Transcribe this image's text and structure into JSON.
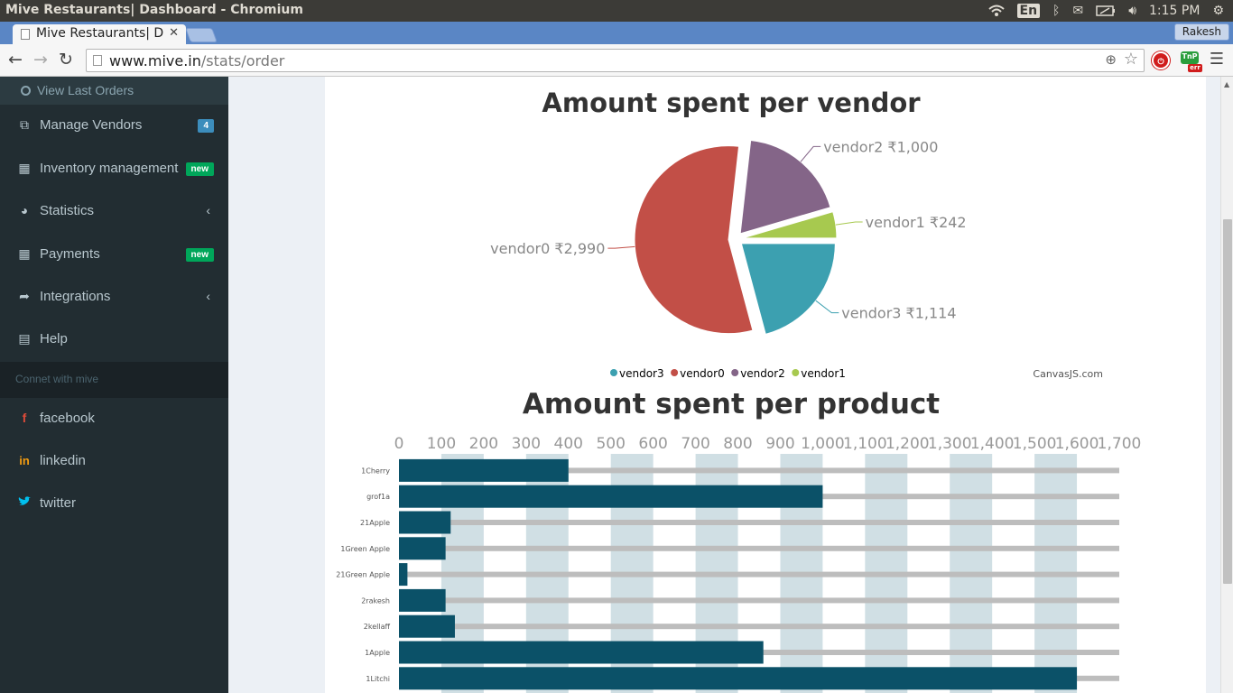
{
  "os": {
    "window_title": "Mive Restaurants| Dashboard - Chromium",
    "lang": "En",
    "clock": "1:15 PM"
  },
  "browser": {
    "tab_title": "Mive Restaurants| D",
    "profile": "Rakesh",
    "url_host": "www.mive.in",
    "url_path": "/stats/order",
    "ext_label": "TnP",
    "ext_badge": "err"
  },
  "sidebar": {
    "sub_item": "View Last Orders",
    "items": [
      {
        "label": "Manage Vendors",
        "icon": "copy-icon",
        "badge": "4"
      },
      {
        "label": "Inventory management",
        "icon": "grid-icon",
        "badge": "new"
      },
      {
        "label": "Statistics",
        "icon": "pie-icon",
        "chevron": "‹"
      },
      {
        "label": "Payments",
        "icon": "grid-icon",
        "badge": "new"
      },
      {
        "label": "Integrations",
        "icon": "share-icon",
        "chevron": "‹"
      },
      {
        "label": "Help",
        "icon": "book-icon"
      }
    ],
    "section_header": "Connet with mive",
    "social": [
      {
        "label": "facebook",
        "icon_glyph": "f",
        "color": "#dd4b39"
      },
      {
        "label": "linkedin",
        "icon_glyph": "in",
        "color": "#f39c12"
      },
      {
        "label": "twitter",
        "icon_glyph": "🐦",
        "color": "#00c0ef"
      }
    ]
  },
  "chart_data": [
    {
      "type": "pie",
      "title": "Amount spent per vendor",
      "slices": [
        {
          "name": "vendor3",
          "value": 1114,
          "label": "vendor3 ₹1,114",
          "color": "#3ca0b0"
        },
        {
          "name": "vendor0",
          "value": 2990,
          "label": "vendor0 ₹2,990",
          "color": "#c24f47"
        },
        {
          "name": "vendor2",
          "value": 1000,
          "label": "vendor2 ₹1,000",
          "color": "#846588"
        },
        {
          "name": "vendor1",
          "value": 242,
          "label": "vendor1 ₹242",
          "color": "#a7c94f"
        }
      ],
      "legend": [
        "vendor3",
        "vendor0",
        "vendor2",
        "vendor1"
      ],
      "legend_placement": "bottom",
      "credit": "CanvasJS.com"
    },
    {
      "type": "bar",
      "orientation": "horizontal",
      "title": "Amount spent per product",
      "categories": [
        "1Cherry",
        "grof1a",
        "21Apple",
        "1Green Apple",
        "21Green Apple",
        "2rakesh",
        "2kellaff",
        "1Apple",
        "1Litchi"
      ],
      "values": [
        400,
        1000,
        122,
        110,
        20,
        110,
        132,
        860,
        1600
      ],
      "ticks": [
        "0",
        "100",
        "200",
        "300",
        "400",
        "500",
        "600",
        "700",
        "800",
        "900",
        "1,000",
        "1,100",
        "1,200",
        "1,300",
        "1,400",
        "1,500",
        "1,600",
        "1,700"
      ],
      "xlim": [
        0,
        1700
      ],
      "axis_position": "top",
      "bar_color": "#0b5168",
      "grid": true
    }
  ]
}
